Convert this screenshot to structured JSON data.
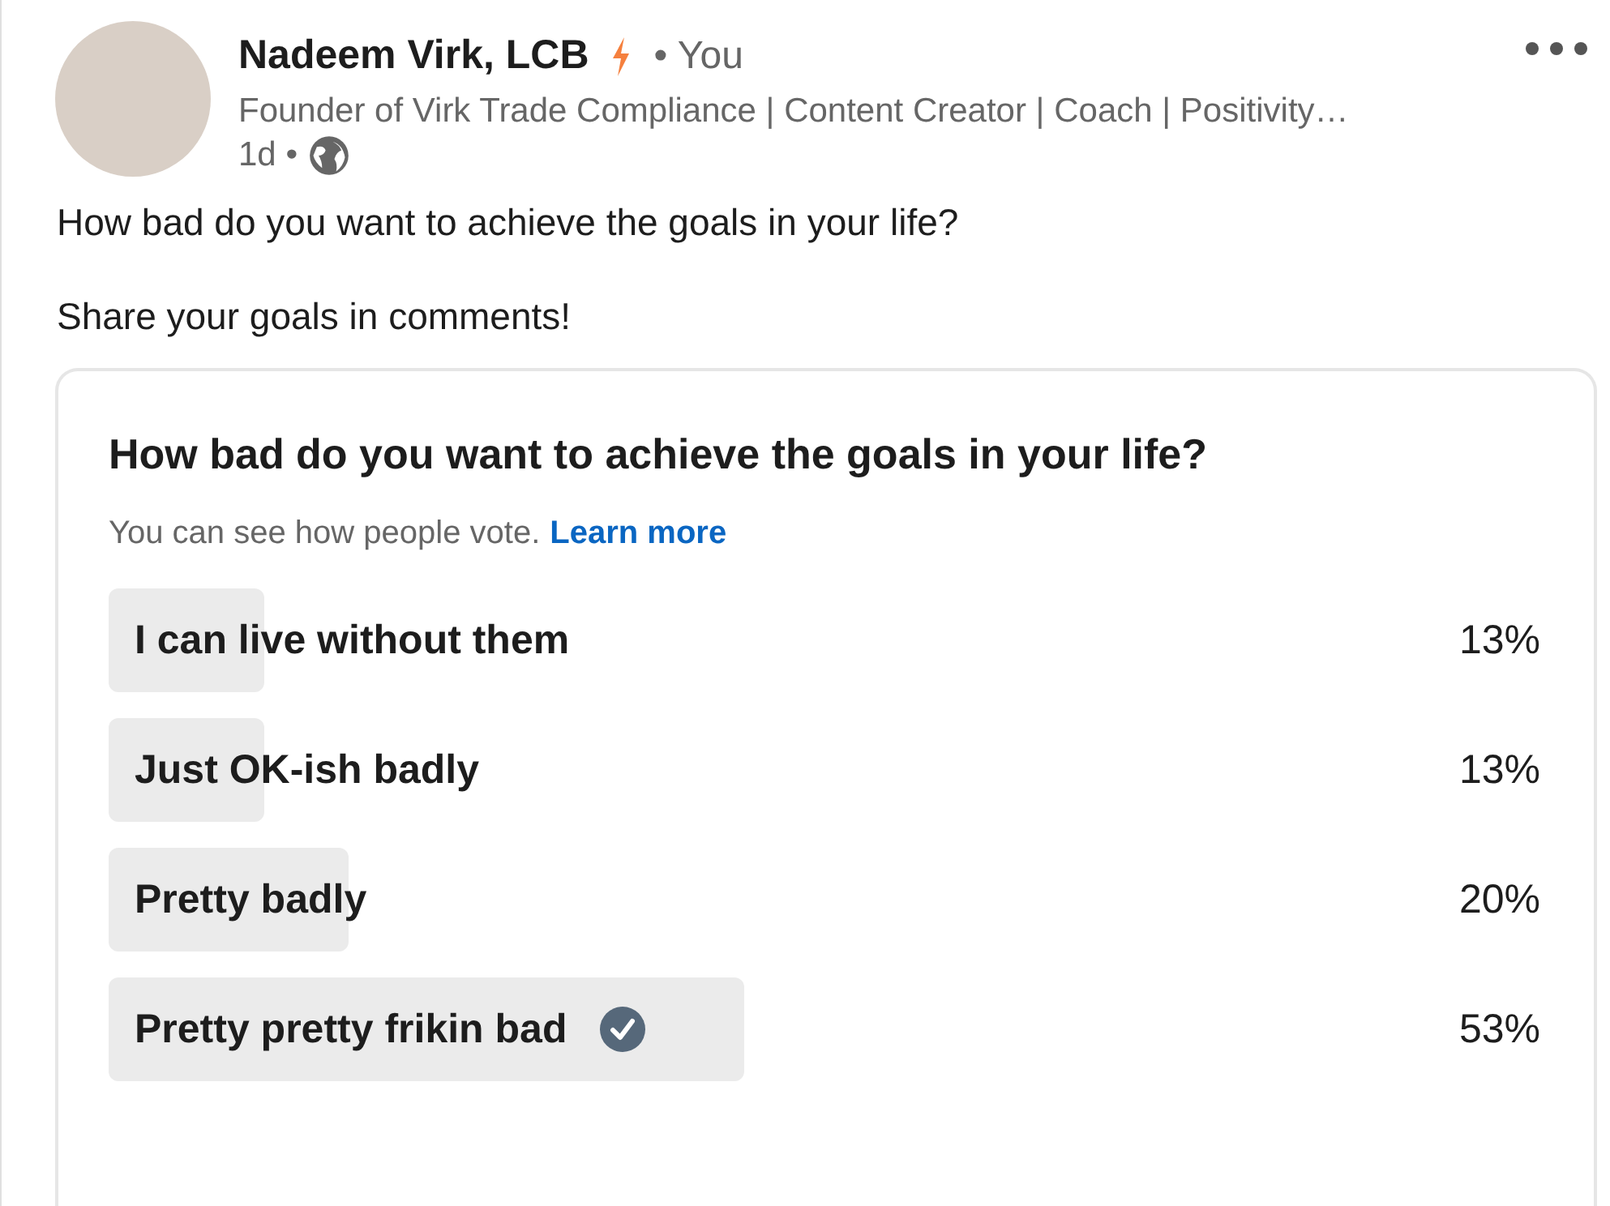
{
  "author": {
    "name": "Nadeem Virk, LCB",
    "relation": "• You",
    "headline": "Founder of Virk Trade Compliance | Content Creator | Coach | Positivity…",
    "time": "1d •"
  },
  "post": {
    "paragraphs": [
      "How bad do you want to achieve the goals in your life?",
      "Share your goals in comments!"
    ]
  },
  "poll": {
    "question": "How bad do you want to achieve the goals in your life?",
    "note": "You can see how people vote.",
    "link": "Learn more",
    "options": [
      {
        "label": "I can live without them",
        "percent": "13%",
        "level": 0.13,
        "selected": false
      },
      {
        "label": "Just OK-ish badly",
        "percent": "13%",
        "level": 0.13,
        "selected": false
      },
      {
        "label": "Pretty badly",
        "percent": "20%",
        "level": 0.2,
        "selected": false
      },
      {
        "label": "Pretty pretty frikin bad",
        "percent": "53%",
        "level": 0.53,
        "selected": true
      }
    ]
  }
}
